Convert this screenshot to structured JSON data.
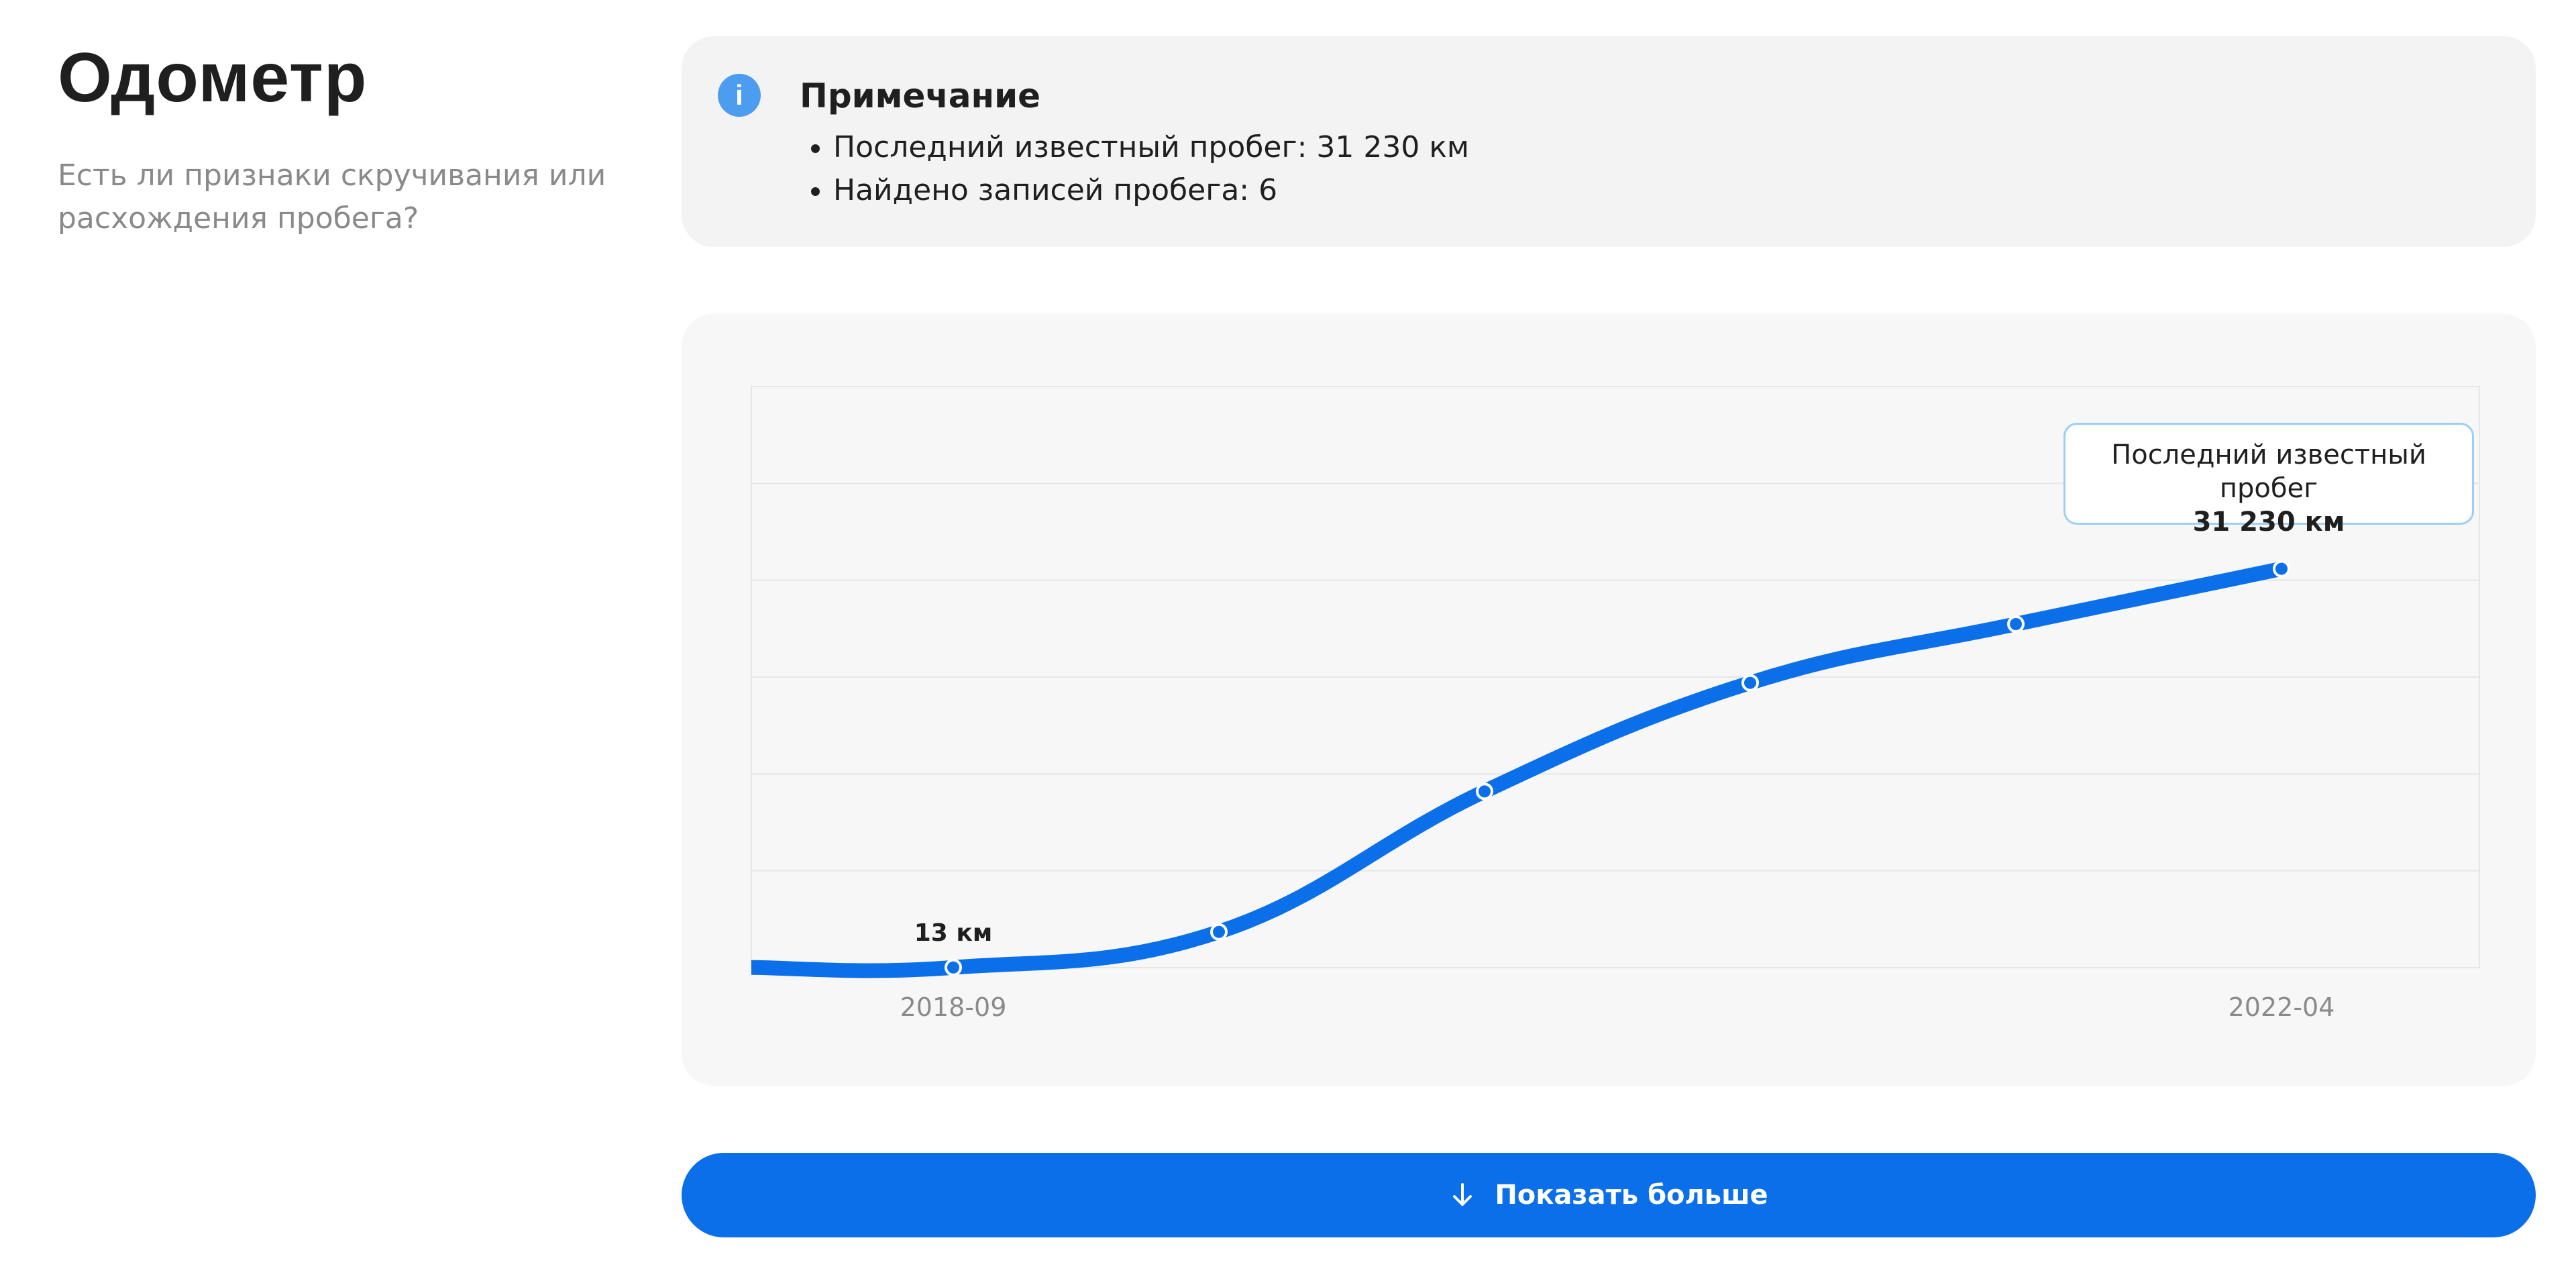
{
  "header": {
    "title": "Одометр",
    "subtitle": "Есть ли признаки скручивания или расхождения пробега?"
  },
  "note": {
    "icon": "info-icon",
    "title": "Примечание",
    "items": [
      "Последний известный пробег: 31 230 км",
      "Найдено записей пробега: 6"
    ]
  },
  "colors": {
    "accent": "#0a6fe8",
    "info": "#4c9df0",
    "tooltip_border": "#9ccff7"
  },
  "chart_data": {
    "type": "line",
    "title": "",
    "xlabel": "",
    "ylabel": "",
    "grid": true,
    "x_ticks": [
      "2018-09",
      "2022-04"
    ],
    "series": [
      {
        "points": [
          {
            "x": "2018-09",
            "y": 13
          },
          {
            "x": "2019-05",
            "y": 2800
          },
          {
            "x": "2020-01",
            "y": 13800
          },
          {
            "x": "2020-09",
            "y": 22300
          },
          {
            "x": "2021-06",
            "y": 26900
          },
          {
            "x": "2022-04",
            "y": 31230
          }
        ]
      }
    ],
    "ylim": [
      0,
      45500
    ],
    "labels": {
      "first_point": "13 км",
      "tooltip_title": "Последний известный пробег",
      "tooltip_value": "31 230 км"
    }
  },
  "actions": {
    "show_more_label": "Показать больше",
    "show_more_icon": "arrow-down-icon"
  }
}
